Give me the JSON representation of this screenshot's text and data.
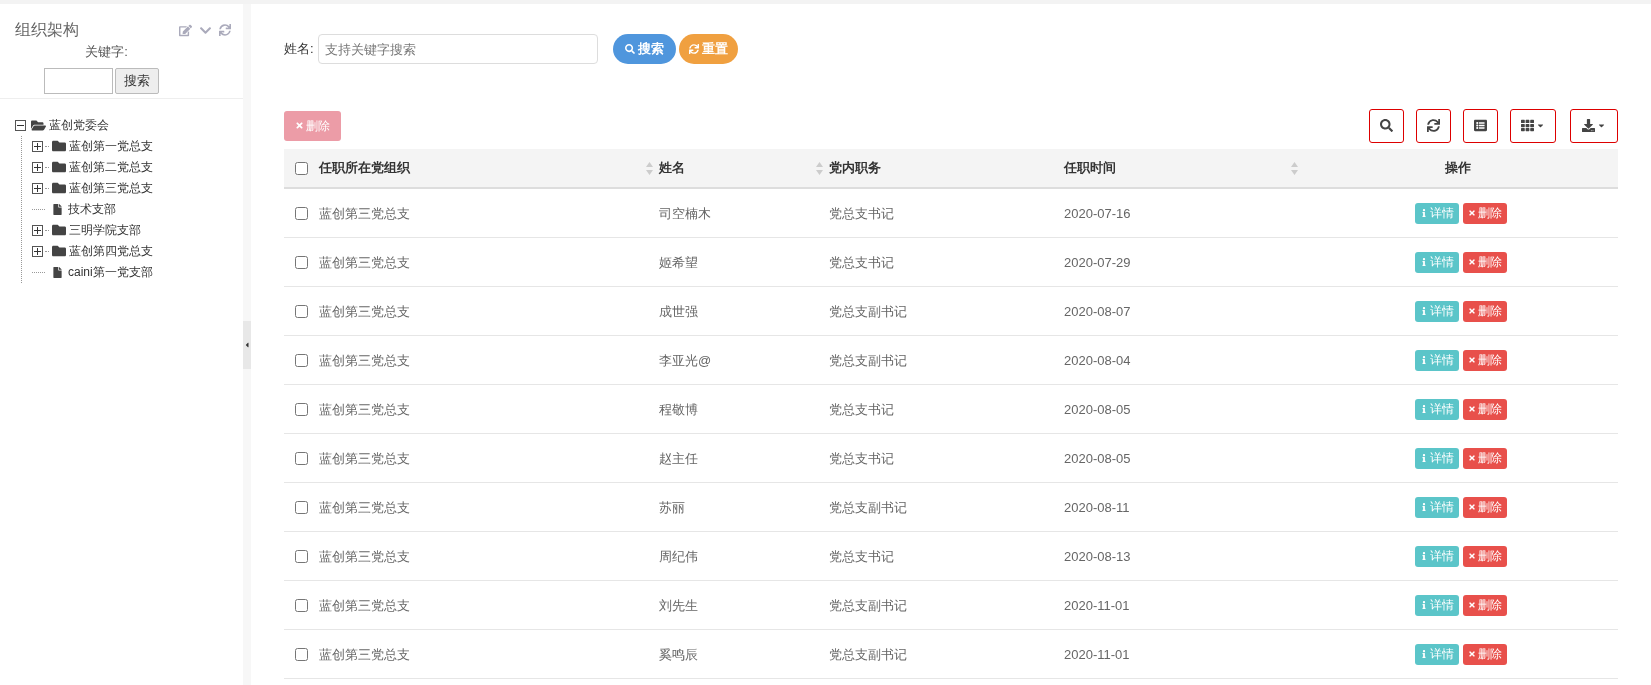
{
  "sidebar": {
    "title": "组织架构",
    "keyword_label": "关键字:",
    "search_button": "搜索",
    "tree": [
      {
        "label": "蓝创党委会",
        "kind": "folder",
        "expanded": true,
        "children": [
          {
            "label": "蓝创第一党总支",
            "kind": "folder",
            "expanded": false
          },
          {
            "label": "蓝创第二党总支",
            "kind": "folder",
            "expanded": false
          },
          {
            "label": "蓝创第三党总支",
            "kind": "folder",
            "expanded": false
          },
          {
            "label": "技术支部",
            "kind": "file"
          },
          {
            "label": "三明学院支部",
            "kind": "folder",
            "expanded": false
          },
          {
            "label": "蓝创第四党总支",
            "kind": "folder",
            "expanded": false
          },
          {
            "label": "caini第一党支部",
            "kind": "file"
          }
        ]
      }
    ]
  },
  "filter": {
    "label": "姓名:",
    "placeholder": "支持关键字搜索",
    "search_button": "搜索",
    "reset_button": "重置"
  },
  "toolbar": {
    "delete_button": {
      "label": "删除",
      "disabled": true
    }
  },
  "table": {
    "select_all": false,
    "columns": [
      {
        "label": "任职所在党组织",
        "sortable": true
      },
      {
        "label": "姓名",
        "sortable": true
      },
      {
        "label": "党内职务",
        "sortable": false
      },
      {
        "label": "任职时间",
        "sortable": true
      },
      {
        "label": "操作",
        "sortable": false
      }
    ],
    "rows": [
      {
        "checked": false,
        "cells": [
          "蓝创第三党总支",
          "司空楠木",
          "党总支书记",
          "2020-07-16"
        ],
        "actions": [
          "详情",
          "删除"
        ]
      },
      {
        "checked": false,
        "cells": [
          "蓝创第三党总支",
          "姬希望",
          "党总支书记",
          "2020-07-29"
        ],
        "actions": [
          "详情",
          "删除"
        ]
      },
      {
        "checked": false,
        "cells": [
          "蓝创第三党总支",
          "成世强",
          "党总支副书记",
          "2020-08-07"
        ],
        "actions": [
          "详情",
          "删除"
        ]
      },
      {
        "checked": false,
        "cells": [
          "蓝创第三党总支",
          "李亚光@",
          "党总支副书记",
          "2020-08-04"
        ],
        "actions": [
          "详情",
          "删除"
        ]
      },
      {
        "checked": false,
        "cells": [
          "蓝创第三党总支",
          "程敬博",
          "党总支书记",
          "2020-08-05"
        ],
        "actions": [
          "详情",
          "删除"
        ]
      },
      {
        "checked": false,
        "cells": [
          "蓝创第三党总支",
          "赵主任",
          "党总支书记",
          "2020-08-05"
        ],
        "actions": [
          "详情",
          "删除"
        ]
      },
      {
        "checked": false,
        "cells": [
          "蓝创第三党总支",
          "苏丽",
          "党总支副书记",
          "2020-08-11"
        ],
        "actions": [
          "详情",
          "删除"
        ]
      },
      {
        "checked": false,
        "cells": [
          "蓝创第三党总支",
          "周纪伟",
          "党总支书记",
          "2020-08-13"
        ],
        "actions": [
          "详情",
          "删除"
        ]
      },
      {
        "checked": false,
        "cells": [
          "蓝创第三党总支",
          "刘先生",
          "党总支副书记",
          "2020-11-01"
        ],
        "actions": [
          "详情",
          "删除"
        ]
      },
      {
        "checked": false,
        "cells": [
          "蓝创第三党总支",
          "奚鸣辰",
          "党总支副书记",
          "2020-11-01"
        ],
        "actions": [
          "详情",
          "删除"
        ]
      }
    ]
  }
}
